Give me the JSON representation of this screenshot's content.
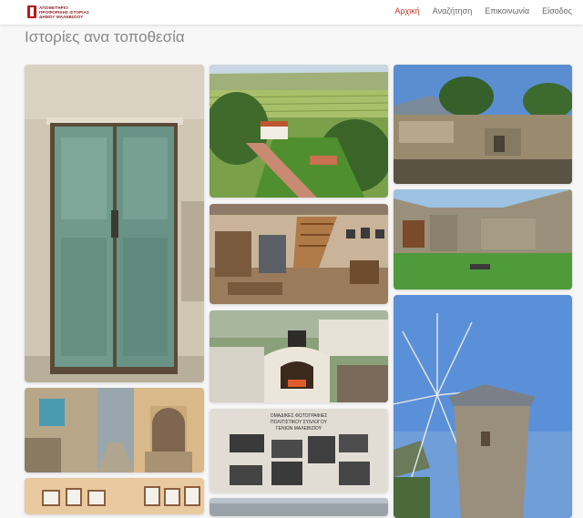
{
  "nav": {
    "logo_lines": [
      "ΑΠΟΘΕΤΗΡΙΟ",
      "ΠΡΟΦΟΡΙΚΗΣ ΙΣΤΟΡΙΑΣ",
      "ΔΗΜΟΥ ΜΑΛΕΒΙΖΙΟΥ"
    ],
    "items": [
      {
        "label": "Αρχική",
        "active": true
      },
      {
        "label": "Αναζήτηση",
        "active": false
      },
      {
        "label": "Επικοινωνία",
        "active": false
      },
      {
        "label": "Είσοδος",
        "active": false
      }
    ]
  },
  "page": {
    "title": "Ιστορίες ανα τοποθεσία"
  },
  "gallery": [
    {
      "id": "door",
      "subject": "old green wooden door"
    },
    {
      "id": "aerial",
      "subject": "aerial view of farm with olive groves"
    },
    {
      "id": "ruins",
      "subject": "stone ruins under blue sky"
    },
    {
      "id": "museum-room",
      "subject": "folk museum interior with staircase"
    },
    {
      "id": "ruined-courtyard",
      "subject": "ruined stone building with green courtyard"
    },
    {
      "id": "alley",
      "subject": "village alley with stone houses"
    },
    {
      "id": "oven",
      "subject": "traditional stone oven"
    },
    {
      "id": "windmill",
      "subject": "stone windmill with sails"
    },
    {
      "id": "photo-board",
      "subject": "board of old photographs"
    },
    {
      "id": "photo-wall",
      "subject": "wall with framed photographs"
    },
    {
      "id": "partial-bottom",
      "subject": "partial image"
    }
  ],
  "photo_board": {
    "caption_lines": [
      "ΟΜΑΔΙΚΕΣ ΦΩΤΟΓΡΑΦΙΕΣ",
      "ΠΟΛΙΤΙΣΤΙΚΟΥ ΣΥΛΛΟΓΟΥ",
      "ΓΕΝΙΩΝ ΜΑΛΕΒΙΖΙΟΥ"
    ]
  }
}
